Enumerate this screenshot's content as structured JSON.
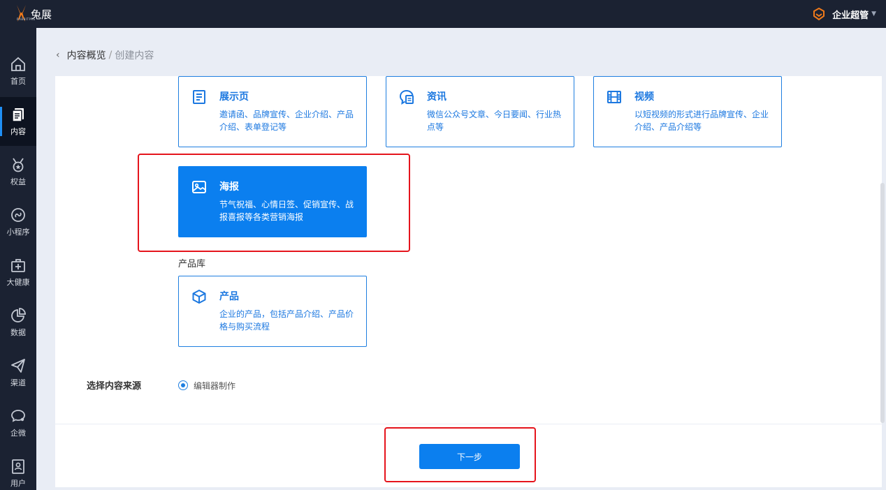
{
  "app": {
    "logo_text": "兔展",
    "logo_sub": "RABBITPRE",
    "user_name": "企业超管",
    "accent_color": "#0b7fef",
    "highlight_color": "#e5141c"
  },
  "sidebar": {
    "items": [
      {
        "label": "首页",
        "icon": "home-icon"
      },
      {
        "label": "内容",
        "icon": "content-icon",
        "active": true
      },
      {
        "label": "权益",
        "icon": "medal-icon"
      },
      {
        "label": "小程序",
        "icon": "miniprogram-icon"
      },
      {
        "label": "大健康",
        "icon": "medical-kit-icon"
      },
      {
        "label": "数据",
        "icon": "pie-chart-icon"
      },
      {
        "label": "渠道",
        "icon": "paper-plane-icon"
      },
      {
        "label": "企微",
        "icon": "chat-icon"
      },
      {
        "label": "用户",
        "icon": "user-card-icon"
      }
    ]
  },
  "breadcrumb": {
    "parent": "内容概览",
    "separator": "/",
    "current": "创建内容"
  },
  "cards": {
    "display_page": {
      "title": "展示页",
      "desc": "邀请函、品牌宣传、企业介绍、产品介绍、表单登记等",
      "icon": "document-icon"
    },
    "news": {
      "title": "资讯",
      "desc": "微信公众号文章、今日要闻、行业热点等",
      "icon": "news-chat-icon"
    },
    "video": {
      "title": "视频",
      "desc": "以短视频的形式进行品牌宣传、企业介绍、产品介绍等",
      "icon": "film-icon"
    },
    "poster": {
      "title": "海报",
      "desc": "节气祝福、心情日签、促销宣传、战报喜报等各类营销海报",
      "icon": "image-icon",
      "selected": true
    },
    "product": {
      "title": "产品",
      "desc": "企业的产品，包括产品介绍、产品价格与购买流程",
      "icon": "cube-icon"
    }
  },
  "product_section_label": "产品库",
  "source": {
    "label": "选择内容来源",
    "option": "编辑器制作",
    "selected": true
  },
  "footer": {
    "next_label": "下一步"
  }
}
